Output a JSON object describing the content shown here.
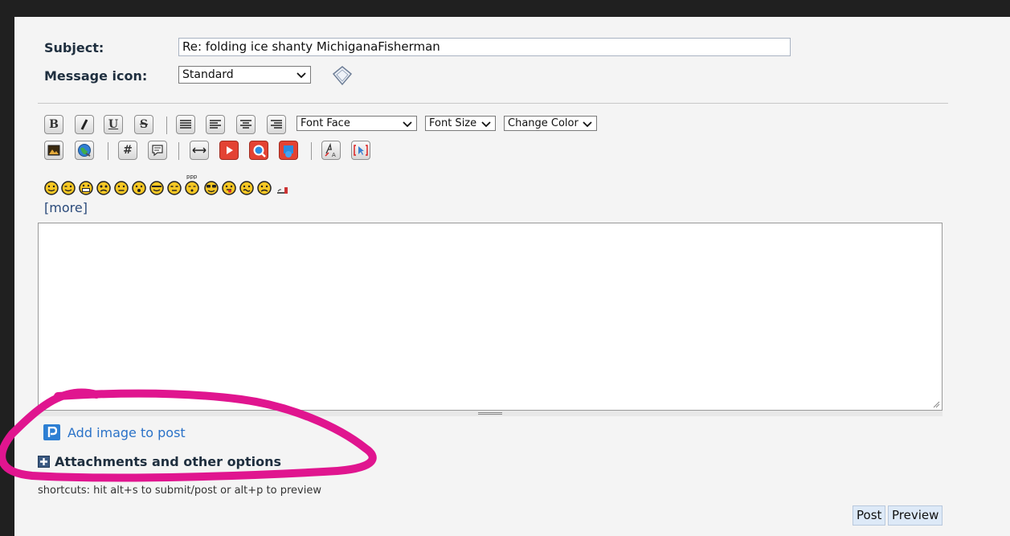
{
  "form": {
    "subject_label": "Subject:",
    "subject_value": "Re: folding ice shanty  MichiganaFisherman",
    "icon_label": "Message icon:",
    "icon_value": "Standard"
  },
  "toolbar": {
    "bold": "B",
    "italic": "I",
    "underline": "U",
    "strike": "S",
    "hash": "#",
    "font_face": "Font Face",
    "font_size": "Font Size",
    "change_color": "Change Color"
  },
  "smilies": {
    "more": "[more]"
  },
  "footer": {
    "add_image": "Add image to post",
    "attachments": "Attachments and other options",
    "shortcuts": "shortcuts: hit alt+s to submit/post or alt+p to preview",
    "post": "Post",
    "preview": "Preview"
  },
  "colors": {
    "accent": "#2a72c8",
    "annotation": "#e0158f",
    "background": "#202020",
    "panel": "#f4f4f4"
  },
  "icons": [
    "message-icon-preview",
    "bold-icon",
    "italic-icon",
    "underline-icon",
    "strikethrough-icon",
    "align-justify-icon",
    "align-left-icon",
    "align-center-icon",
    "align-right-icon",
    "image-icon",
    "link-icon",
    "hash-icon",
    "quote-icon",
    "horizontal-rule-icon",
    "youtube-icon",
    "search-video-icon",
    "media-icon",
    "spellcheck-icon",
    "select-icon",
    "photo-icon",
    "expand-icon"
  ]
}
